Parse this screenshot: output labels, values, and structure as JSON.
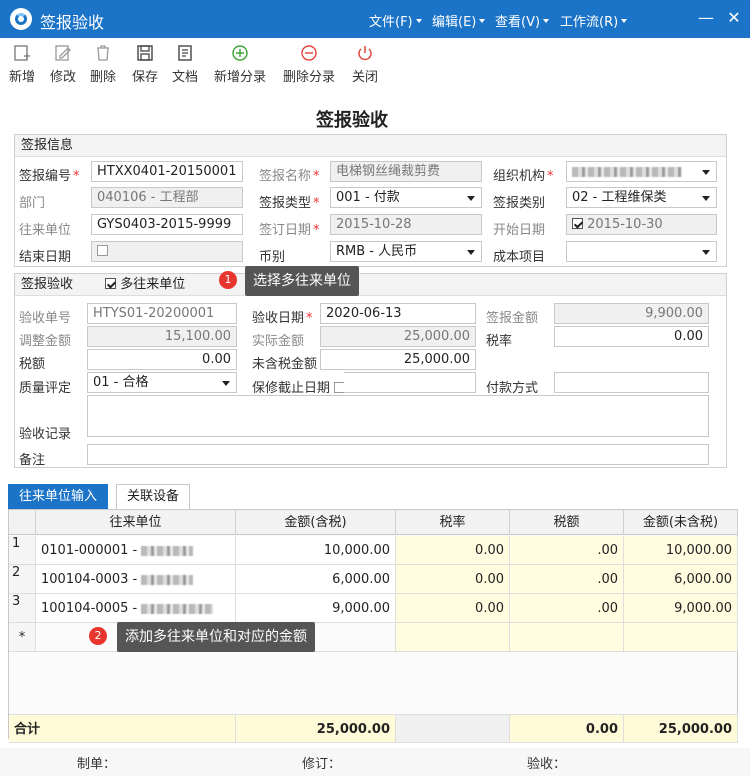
{
  "window": {
    "title": "签报验收",
    "menus": [
      "文件(F)",
      "编辑(E)",
      "查看(V)",
      "工作流(R)"
    ]
  },
  "toolbar": [
    "新增",
    "修改",
    "删除",
    "保存",
    "文档",
    "新增分录",
    "删除分录",
    "关闭"
  ],
  "heading": "签报验收",
  "info": {
    "section": "签报信息",
    "labels": {
      "code": "签报编号",
      "name": "签报名称",
      "org": "组织机构",
      "dept": "部门",
      "type": "签报类型",
      "cat": "签报类别",
      "partner": "往来单位",
      "signdate": "签订日期",
      "startdate": "开始日期",
      "enddate": "结束日期",
      "currency": "币别",
      "costitem": "成本项目"
    },
    "values": {
      "code": "HTXX0401-20150001",
      "name": "电梯钢丝绳裁剪费",
      "dept": "040106 - 工程部",
      "type": "001 - 付款",
      "cat": "02 - 工程维保类",
      "partner": "GYS0403-2015-9999",
      "signdate": "2015-10-28",
      "startdate": "2015-10-30",
      "currency": "RMB - 人民币"
    }
  },
  "accept": {
    "section": "签报验收",
    "multi_label": "多往来单位",
    "labels": {
      "no": "验收单号",
      "date": "验收日期",
      "amount": "签报金额",
      "adjust": "调整金额",
      "actual": "实际金额",
      "taxrate": "税率",
      "tax": "税额",
      "untaxed": "未含税金额",
      "quality": "质量评定",
      "warranty": "保修截止日期",
      "paytype": "付款方式",
      "record": "验收记录",
      "note": "备注"
    },
    "values": {
      "no": "HTYS01-20200001",
      "date": "2020-06-13",
      "amount": "9,900.00",
      "adjust": "15,100.00",
      "actual": "25,000.00",
      "taxrate": "0.00",
      "tax": "0.00",
      "untaxed": "25,000.00",
      "quality": "01 - 合格"
    }
  },
  "callouts": {
    "one": "1",
    "one_text": "选择多往来单位",
    "two": "2",
    "two_text": "添加多往来单位和对应的金额"
  },
  "tabs": [
    "往来单位输入",
    "关联设备"
  ],
  "grid": {
    "columns": [
      "往来单位",
      "金额(含税)",
      "税率",
      "税额",
      "金额(未含税)"
    ],
    "rows": [
      {
        "n": "1",
        "unit": "0101-000001 -",
        "amount": "10,000.00",
        "rate": "0.00",
        "tax": ".00",
        "net": "10,000.00"
      },
      {
        "n": "2",
        "unit": "100104-0003 -",
        "amount": "6,000.00",
        "rate": "0.00",
        "tax": ".00",
        "net": "6,000.00"
      },
      {
        "n": "3",
        "unit": "100104-0005 -",
        "amount": "9,000.00",
        "rate": "0.00",
        "tax": ".00",
        "net": "9,000.00"
      }
    ],
    "new_row_marker": "*",
    "total": {
      "label": "合计",
      "amount": "25,000.00",
      "tax": "0.00",
      "net": "25,000.00"
    }
  },
  "footer": {
    "maker": "制单：",
    "revise": "修订：",
    "check": "验收："
  },
  "colors": {
    "titlebar": "#1b74c8",
    "required": "#e33333",
    "badge": "#e8362e",
    "cell_yellow": "#fffce0",
    "total_row": "#fffbd8"
  }
}
